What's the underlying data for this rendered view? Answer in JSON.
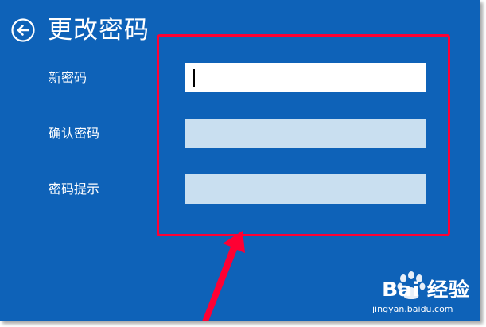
{
  "header": {
    "title": "更改密码"
  },
  "form": {
    "fields": [
      {
        "label": "新密码",
        "value": "",
        "state": "focused"
      },
      {
        "label": "确认密码",
        "value": "",
        "state": "inactive"
      },
      {
        "label": "密码提示",
        "value": "",
        "state": "inactive"
      }
    ]
  },
  "watermark": {
    "brand": "Bai 经验",
    "url": "jingyan.baidu.com"
  },
  "colors": {
    "background": "#0e62b8",
    "field_active": "#ffffff",
    "field_inactive": "#c9dff0",
    "annotation": "#ff0033"
  }
}
